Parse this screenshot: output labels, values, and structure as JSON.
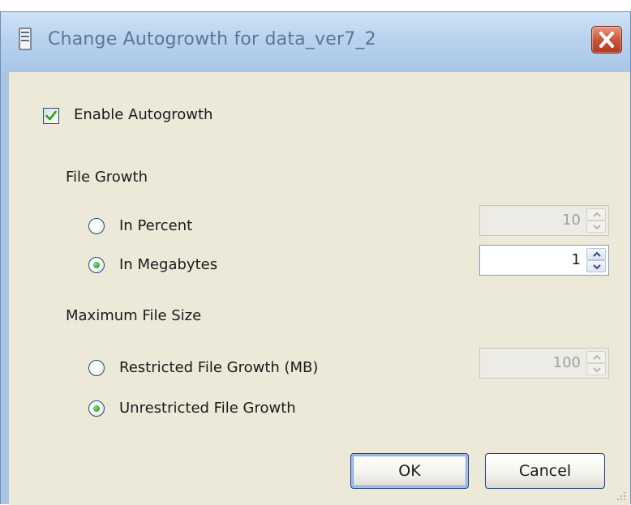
{
  "window": {
    "title": "Change Autogrowth for data_ver7_2",
    "icons": {
      "app": "server-icon",
      "close": "close-icon"
    },
    "colors": {
      "titlebar": "#b9d3ee",
      "title_text": "#5a7599",
      "close": "#c9553d",
      "client": "#ece9d8"
    }
  },
  "enable_autogrowth": {
    "label": "Enable Autogrowth",
    "checked": true
  },
  "file_growth": {
    "heading": "File Growth",
    "in_percent": {
      "label": "In Percent",
      "selected": false,
      "value": "10",
      "enabled": false
    },
    "in_megabytes": {
      "label": "In Megabytes",
      "selected": true,
      "value": "1",
      "enabled": true
    }
  },
  "max_file_size": {
    "heading": "Maximum File Size",
    "restricted": {
      "label": "Restricted File Growth (MB)",
      "selected": false,
      "value": "100",
      "enabled": false
    },
    "unrestricted": {
      "label": "Unrestricted File Growth",
      "selected": true
    }
  },
  "buttons": {
    "ok": "OK",
    "cancel": "Cancel"
  }
}
